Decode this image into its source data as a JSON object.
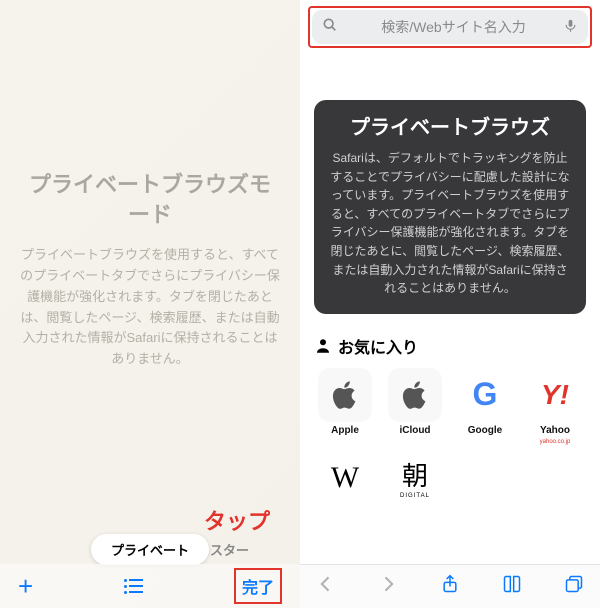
{
  "left": {
    "title": "プライベートブラウズモード",
    "body": "プライベートブラウズを使用すると、すべてのプライベートタブでさらにプライバシー保護機能が強化されます。タブを閉じたあとは、閲覧したページ、検索履歴、または自動入力された情報がSafariに保持されることはありません。",
    "chip": "プライベート",
    "chip_right_partial": "スター",
    "tap": "タップ",
    "done": "完了"
  },
  "right": {
    "search_placeholder": "検索/Webサイト名入力",
    "card_title": "プライベートブラウズ",
    "card_body": "Safariは、デフォルトでトラッキングを防止することでプライバシーに配慮した設計になっています。プライベートブラウズを使用すると、すべてのプライベートタブでさらにプライバシー保護機能が強化されます。タブを閉じたあとに、閲覧したページ、検索履歴、または自動入力された情報がSafariに保持されることはありません。",
    "favorites_heading": "お気に入り",
    "favorites": [
      {
        "label": "Apple",
        "icon": "apple"
      },
      {
        "label": "iCloud",
        "icon": "apple"
      },
      {
        "label": "Google",
        "icon": "google"
      },
      {
        "label": "Yahoo",
        "icon": "yahoo",
        "sub": "yahoo.co.jp"
      },
      {
        "label": "",
        "icon": "wiki"
      },
      {
        "label": "",
        "icon": "asahi",
        "sub": "DIGITAL",
        "text": "朝"
      }
    ]
  }
}
